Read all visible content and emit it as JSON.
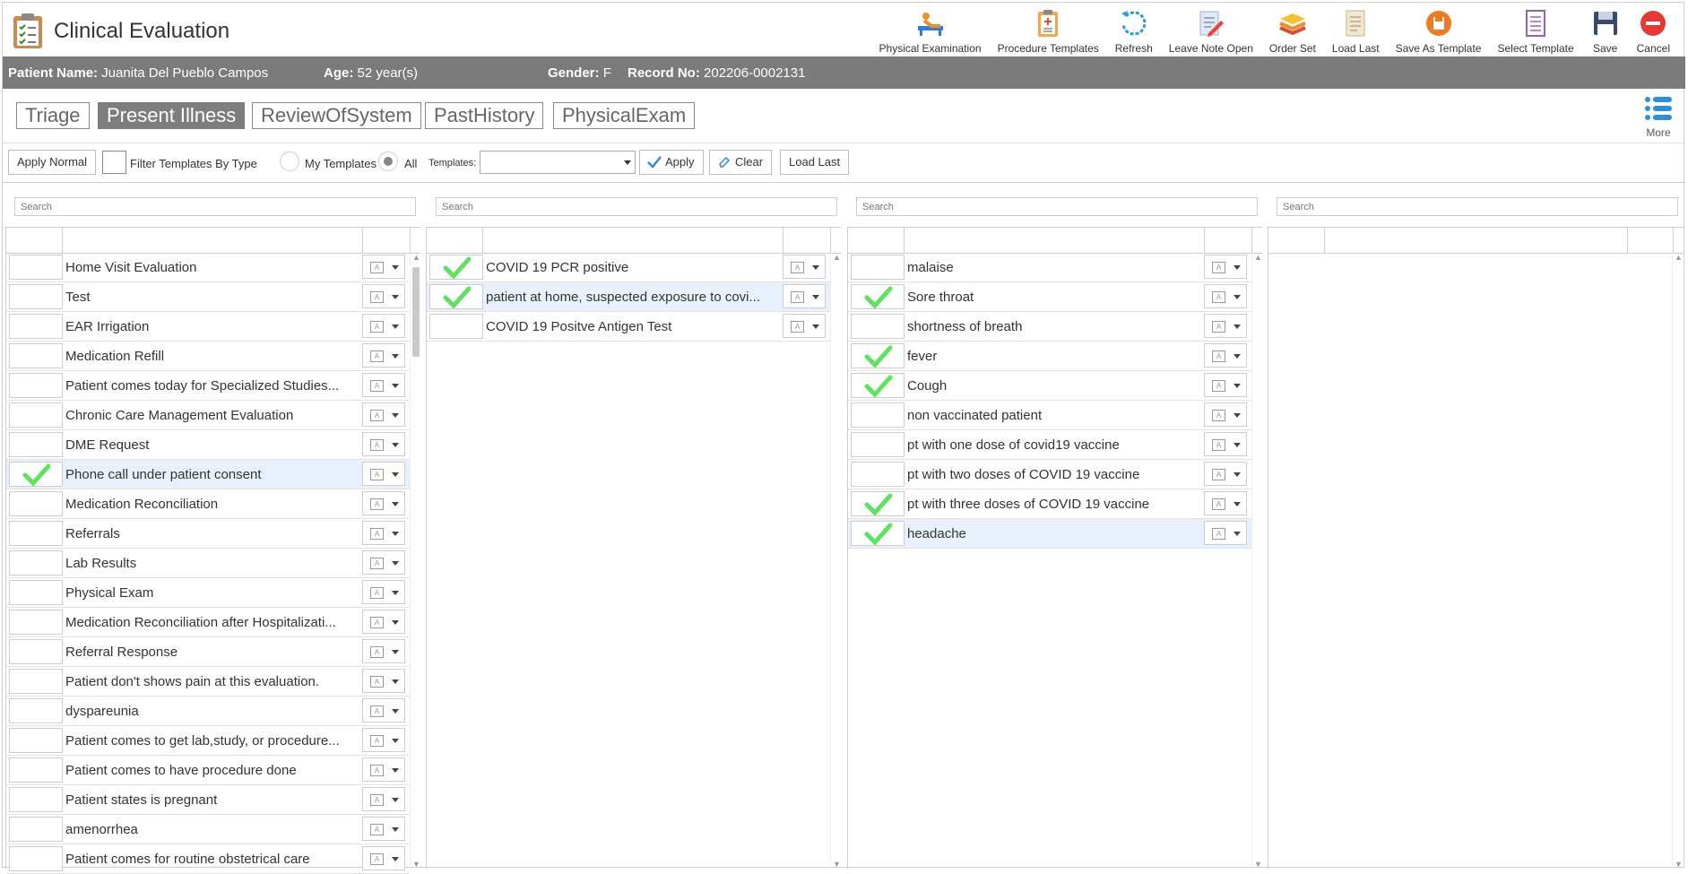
{
  "app": {
    "title": "Clinical Evaluation"
  },
  "toolbar": [
    {
      "label": "Physical Examination",
      "icon": "physical-exam-icon"
    },
    {
      "label": "Procedure Templates",
      "icon": "clipboard-icon"
    },
    {
      "label": "Refresh",
      "icon": "refresh-icon"
    },
    {
      "label": "Leave Note Open",
      "icon": "note-edit-icon"
    },
    {
      "label": "Order Set",
      "icon": "layers-icon"
    },
    {
      "label": "Load Last",
      "icon": "document-icon"
    },
    {
      "label": "Save As Template",
      "icon": "save-circle-icon"
    },
    {
      "label": "Select Template",
      "icon": "template-list-icon"
    },
    {
      "label": "Save",
      "icon": "floppy-icon"
    },
    {
      "label": "Cancel",
      "icon": "cancel-icon"
    }
  ],
  "patient": {
    "name_label": "Patient Name:",
    "name": "Juanita Del Pueblo Campos",
    "age_label": "Age:",
    "age": "52 year(s)",
    "gender_label": "Gender:",
    "gender": "F",
    "record_label": "Record No:",
    "record": "202206-0002131"
  },
  "tabs": [
    {
      "label": "Triage",
      "active": false
    },
    {
      "label": "Present Illness",
      "active": true
    },
    {
      "label": "ReviewOfSystem",
      "active": false
    },
    {
      "label": "PastHistory",
      "active": false
    },
    {
      "label": "PhysicalExam",
      "active": false
    }
  ],
  "more_label": "More",
  "filter": {
    "apply_normal": "Apply Normal",
    "filter_by_type": "Filter Templates By Type",
    "my_templates": "My Templates",
    "all": "All",
    "templates_label": "Templates:",
    "templates_value": "",
    "apply": "Apply",
    "clear": "Clear",
    "load_last": "Load Last"
  },
  "search_placeholder": "Search",
  "colors": {
    "check": "#5ee35e",
    "patient_bar": "#7b7b7b",
    "active_tab": "#7d7d7d"
  },
  "panels": [
    {
      "rows": [
        {
          "label": "Home Visit Evaluation",
          "checked": false
        },
        {
          "label": "Test",
          "checked": false
        },
        {
          "label": "EAR Irrigation",
          "checked": false
        },
        {
          "label": "Medication Refill",
          "checked": false
        },
        {
          "label": "Patient comes today for Specialized Studies...",
          "checked": false
        },
        {
          "label": "Chronic Care Management Evaluation",
          "checked": false
        },
        {
          "label": "DME Request",
          "checked": false
        },
        {
          "label": "Phone call under patient consent",
          "checked": true,
          "selected": true
        },
        {
          "label": "Medication Reconciliation",
          "checked": false
        },
        {
          "label": "Referrals",
          "checked": false
        },
        {
          "label": "Lab Results",
          "checked": false
        },
        {
          "label": "Physical Exam",
          "checked": false
        },
        {
          "label": "Medication Reconciliation after Hospitalizati...",
          "checked": false
        },
        {
          "label": "Referral Response",
          "checked": false
        },
        {
          "label": "Patient don't shows pain at this evaluation.",
          "checked": false
        },
        {
          "label": "dyspareunia",
          "checked": false
        },
        {
          "label": "Patient comes to get lab,study, or procedure...",
          "checked": false
        },
        {
          "label": "Patient comes to have procedure done",
          "checked": false
        },
        {
          "label": "Patient states is pregnant",
          "checked": false
        },
        {
          "label": "amenorrhea",
          "checked": false
        },
        {
          "label": "Patient comes for routine obstetrical care",
          "checked": false
        }
      ]
    },
    {
      "rows": [
        {
          "label": "COVID 19 PCR positive",
          "checked": true
        },
        {
          "label": "patient at home, suspected exposure to covi...",
          "checked": true,
          "selected": true
        },
        {
          "label": "COVID 19 Positve Antigen Test",
          "checked": false
        }
      ]
    },
    {
      "rows": [
        {
          "label": "malaise",
          "checked": false
        },
        {
          "label": "Sore throat",
          "checked": true
        },
        {
          "label": "shortness of breath",
          "checked": false
        },
        {
          "label": "fever",
          "checked": true
        },
        {
          "label": "Cough",
          "checked": true
        },
        {
          "label": "non vaccinated patient",
          "checked": false
        },
        {
          "label": "pt with one dose of covid19 vaccine",
          "checked": false
        },
        {
          "label": "pt with two doses of COVID 19 vaccine",
          "checked": false
        },
        {
          "label": "pt with three doses of COVID 19 vaccine",
          "checked": true
        },
        {
          "label": "headache",
          "checked": true,
          "selected": true
        }
      ]
    },
    {
      "rows": []
    }
  ]
}
